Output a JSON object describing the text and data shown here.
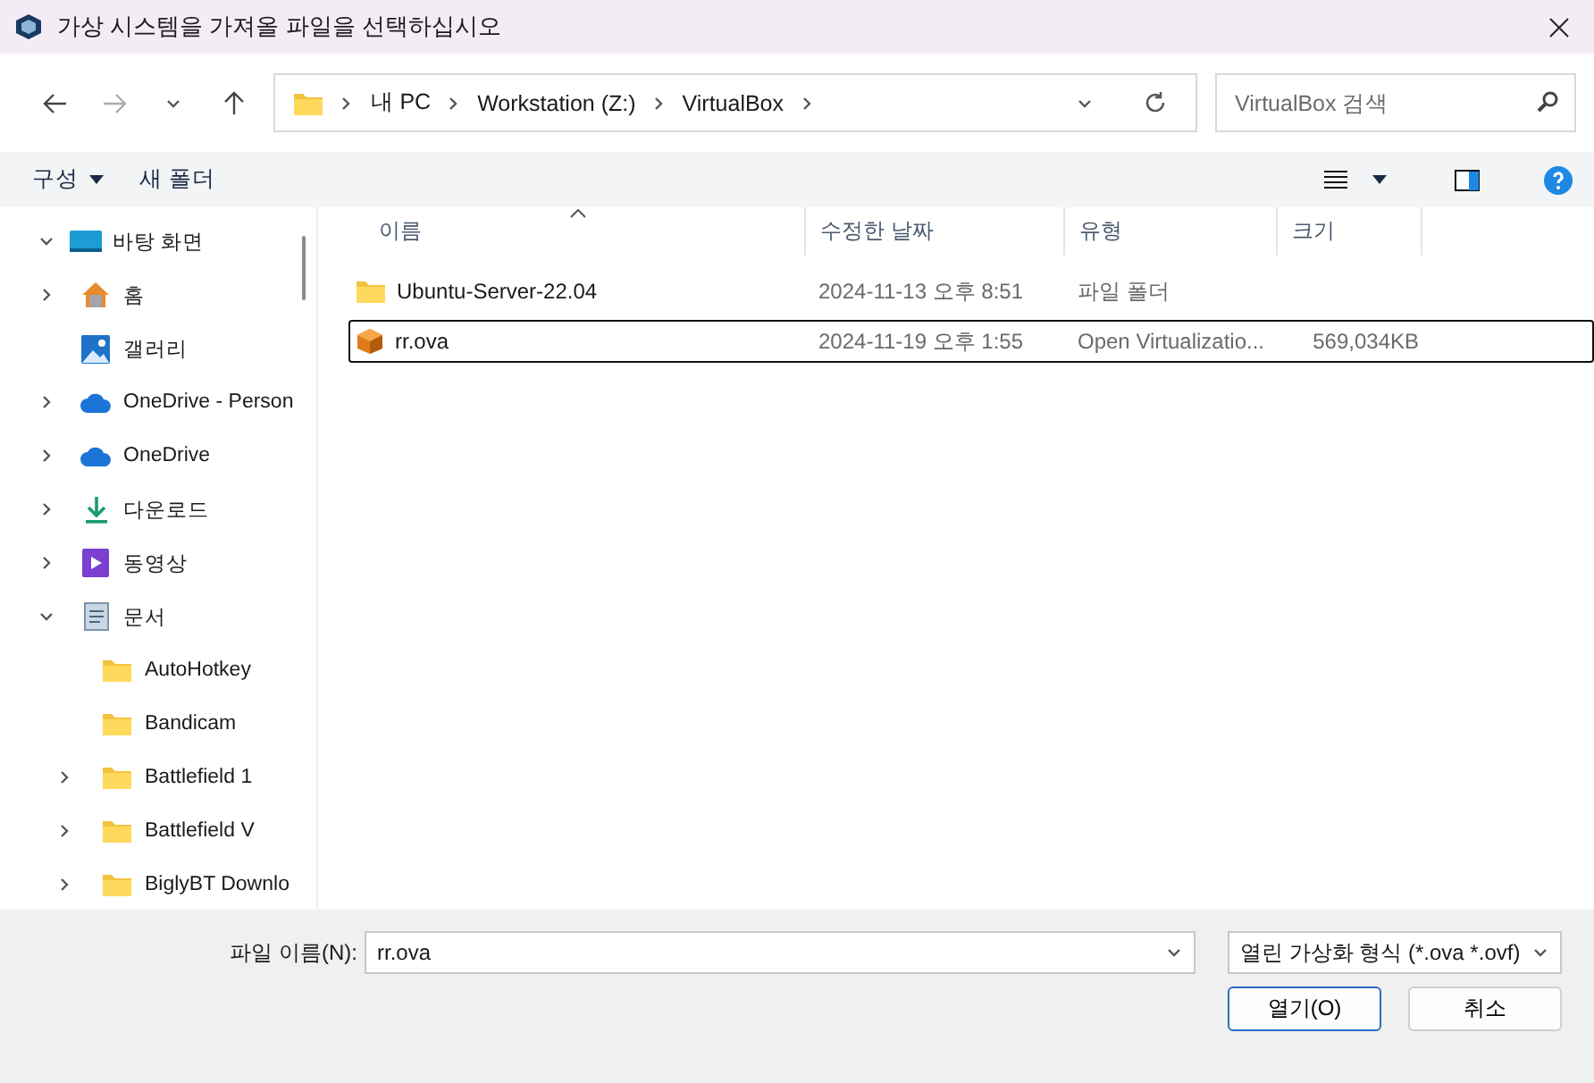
{
  "window": {
    "title": "가상 시스템을 가져올 파일을 선택하십시오"
  },
  "address": {
    "crumbs": [
      "내 PC",
      "Workstation (Z:)",
      "VirtualBox"
    ]
  },
  "search": {
    "placeholder": "VirtualBox 검색"
  },
  "toolbar": {
    "organize": "구성",
    "new_folder": "새 폴더"
  },
  "sidebar": {
    "items": [
      {
        "label": "바탕 화면",
        "kind": "desktop",
        "expanded": true,
        "children": [
          {
            "label": "홈",
            "kind": "home",
            "expanded": false
          },
          {
            "label": "갤러리",
            "kind": "gallery"
          },
          {
            "label": "OneDrive - Person",
            "kind": "cloud",
            "expanded": false
          },
          {
            "label": "OneDrive",
            "kind": "cloud",
            "expanded": false
          },
          {
            "label": "다운로드",
            "kind": "download",
            "expanded": false
          },
          {
            "label": "동영상",
            "kind": "video",
            "expanded": false
          },
          {
            "label": "문서",
            "kind": "document",
            "expanded": true,
            "children": [
              {
                "label": "AutoHotkey",
                "kind": "folder"
              },
              {
                "label": "Bandicam",
                "kind": "folder"
              },
              {
                "label": "Battlefield 1",
                "kind": "folder",
                "expanded": false
              },
              {
                "label": "Battlefield V",
                "kind": "folder",
                "expanded": false
              },
              {
                "label": "BiglyBT Downlo",
                "kind": "folder",
                "expanded": false
              }
            ]
          }
        ]
      }
    ]
  },
  "table": {
    "columns": [
      {
        "label": "이름",
        "sorted": true
      },
      {
        "label": "수정한 날짜",
        "sorted": false
      },
      {
        "label": "유형",
        "sorted": false
      },
      {
        "label": "크기",
        "sorted": false
      }
    ],
    "rows": [
      {
        "kind": "folder",
        "name": "Ubuntu-Server-22.04",
        "date": "2024-11-13 오후 8:51",
        "type": "파일 폴더",
        "selected": false
      },
      {
        "kind": "package",
        "name": "rr.ova",
        "date": "2024-11-19 오후 1:55",
        "type": "Open Virtualizatio...",
        "size": "569,034KB",
        "selected": true
      }
    ]
  },
  "footer": {
    "filename_label": "파일 이름(N):",
    "filename": "rr.ova",
    "filter": "열린 가상화 형식 (*.ova *.ovf)",
    "buttons": [
      {
        "label": "열기(O)",
        "default": true
      },
      {
        "label": "취소",
        "default": false
      }
    ]
  }
}
